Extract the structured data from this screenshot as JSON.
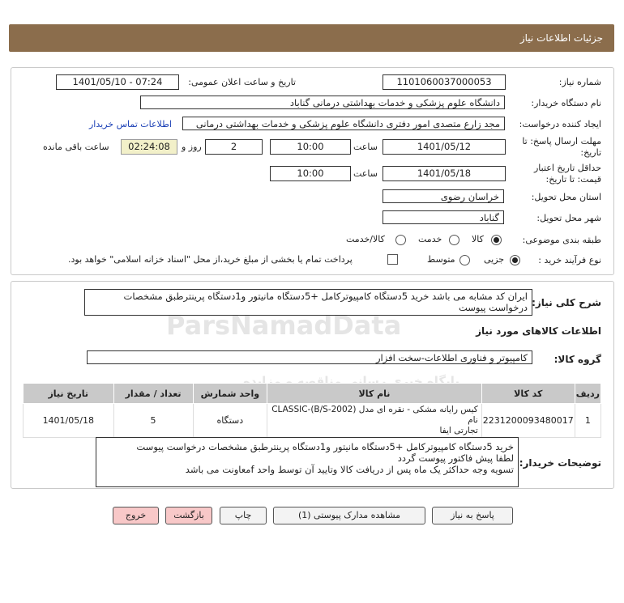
{
  "header": {
    "title": "جزئیات اطلاعات نیاز"
  },
  "form": {
    "need_number_label": "شماره نیاز:",
    "need_number": "1101060037000053",
    "announce_label": "تاریخ و ساعت اعلان عمومی:",
    "announce_value": "1401/05/10 - 07:24",
    "buyer_org_label": "نام دستگاه خریدار:",
    "buyer_org": "دانشگاه علوم پزشکی و خدمات بهداشتی درمانی گناباد",
    "creator_label": "ایجاد کننده درخواست:",
    "creator": "مجد زارع متصدی امور دفتری دانشگاه علوم پزشکی و خدمات بهداشتی درمانی",
    "contact_link": "اطلاعات تماس خریدار",
    "reply_deadline_label_1": "مهلت ارسال پاسخ: تا",
    "reply_deadline_label_2": "تاریخ:",
    "reply_date": "1401/05/12",
    "time_label": "ساعت",
    "reply_time": "10:00",
    "days": "2",
    "days_label": "روز و",
    "remaining": "02:24:08",
    "remaining_label": "ساعت باقی مانده",
    "validity_label_1": "حداقل تاریخ اعتبار",
    "validity_label_2": "قیمت: تا تاریخ:",
    "validity_date": "1401/05/18",
    "validity_time": "10:00",
    "province_label": "استان محل تحویل:",
    "province": "خراسان رضوی",
    "city_label": "شهر محل تحویل:",
    "city": "گناباد",
    "category_label": "طبقه بندی موضوعی:",
    "category_options": [
      "کالا",
      "خدمت",
      "کالا/خدمت"
    ],
    "process_label": "نوع فرآیند خرید :",
    "process_options": [
      "جزیی",
      "متوسط"
    ],
    "process_note": "پرداخت تمام یا بخشی از مبلغ خرید،از محل \"اسناد خزانه اسلامی\" خواهد بود."
  },
  "summary": {
    "label": "شرح کلی نیاز:",
    "text_1": "ایران کد مشابه می باشد خرید 5دستگاه کامپیوترکامل +5دستگاه مانیتور و1دستگاه پرینترطبق مشخصات",
    "text_2": "درخواست پیوست",
    "goods_info_title": "اطلاعات کالاهای مورد نیاز",
    "group_label": "گروه کالا:",
    "group_value": "کامپیوتر و فناوری اطلاعات-سخت افزار"
  },
  "table": {
    "headers": [
      "ردیف",
      "کد کالا",
      "نام کالا",
      "واحد شمارش",
      "تعداد / مقدار",
      "تاریخ نیاز"
    ],
    "rows": [
      {
        "row": "1",
        "code": "2231200093480017",
        "name_1": "کیس رایانه مشکی - نقره ای مدل CLASSIC-(B/S-2002) نام",
        "name_2": "تجارتی ایفا",
        "unit": "دستگاه",
        "qty": "5",
        "date": "1401/05/18"
      }
    ]
  },
  "notes": {
    "label": "توضیحات خریدار:",
    "line_1": "خرید 5دستگاه کامپیوترکامل +5دستگاه مانیتور و1دستگاه پرینترطبق مشخصات درخواست پیوست",
    "line_2": "لطفا پیش فاکتور پیوست گردد",
    "line_3": "تسویه وجه حداکثر یک ماه پس از دریافت کالا وتایید آن توسط واحد fمعاونت می باشد"
  },
  "buttons": {
    "reply": "پاسخ به نیاز",
    "docs": "مشاهده مدارک پیوستی (1)",
    "print": "چاپ",
    "back": "بازگشت",
    "exit": "خروج"
  },
  "watermark": {
    "brand": "ParsNamadData",
    "subtitle": "پایگاه خبری رسانی مناقصه و مزایده"
  },
  "colors": {
    "title_bar": "#8b6d4c",
    "table_header": "#c9c9c9",
    "remaining_bg": "#f2f0c9",
    "exit_btn": "#f8c8c8"
  }
}
